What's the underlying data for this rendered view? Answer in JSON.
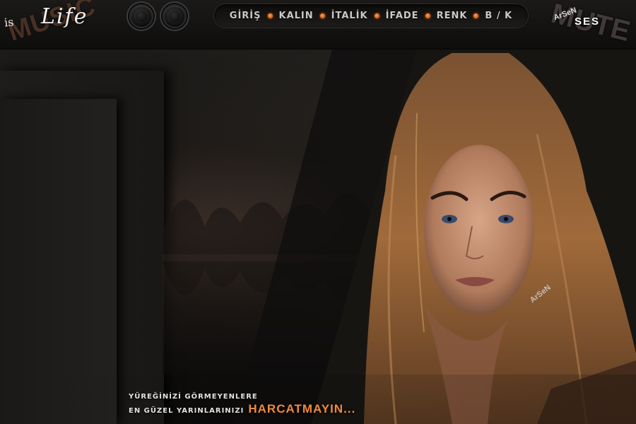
{
  "header": {
    "logo_left": {
      "word_back": "MUSIC",
      "prefix": "is",
      "word": "Life"
    },
    "logo_right": {
      "word_back": "MUTE",
      "small": "ArSeN",
      "word": "SES"
    }
  },
  "controls": {
    "knob_1_icon": "volume-knob-icon",
    "knob_2_icon": "volume-knob-icon"
  },
  "menu": {
    "items": [
      "GİRİŞ",
      "KALIN",
      "İTALİK",
      "İFADE",
      "RENK",
      "B / K"
    ],
    "separator_color": "#ff7a1a"
  },
  "tagline": {
    "line1": "YÜREĞİNİZİ GÖRMEYENLERE",
    "line2": "EN GÜZEL YARINLARINIZI",
    "highlight": "HARCATMAYIN..."
  },
  "watermark": "ArSeN",
  "colors": {
    "accent": "#f08a3c",
    "background": "#141311"
  }
}
